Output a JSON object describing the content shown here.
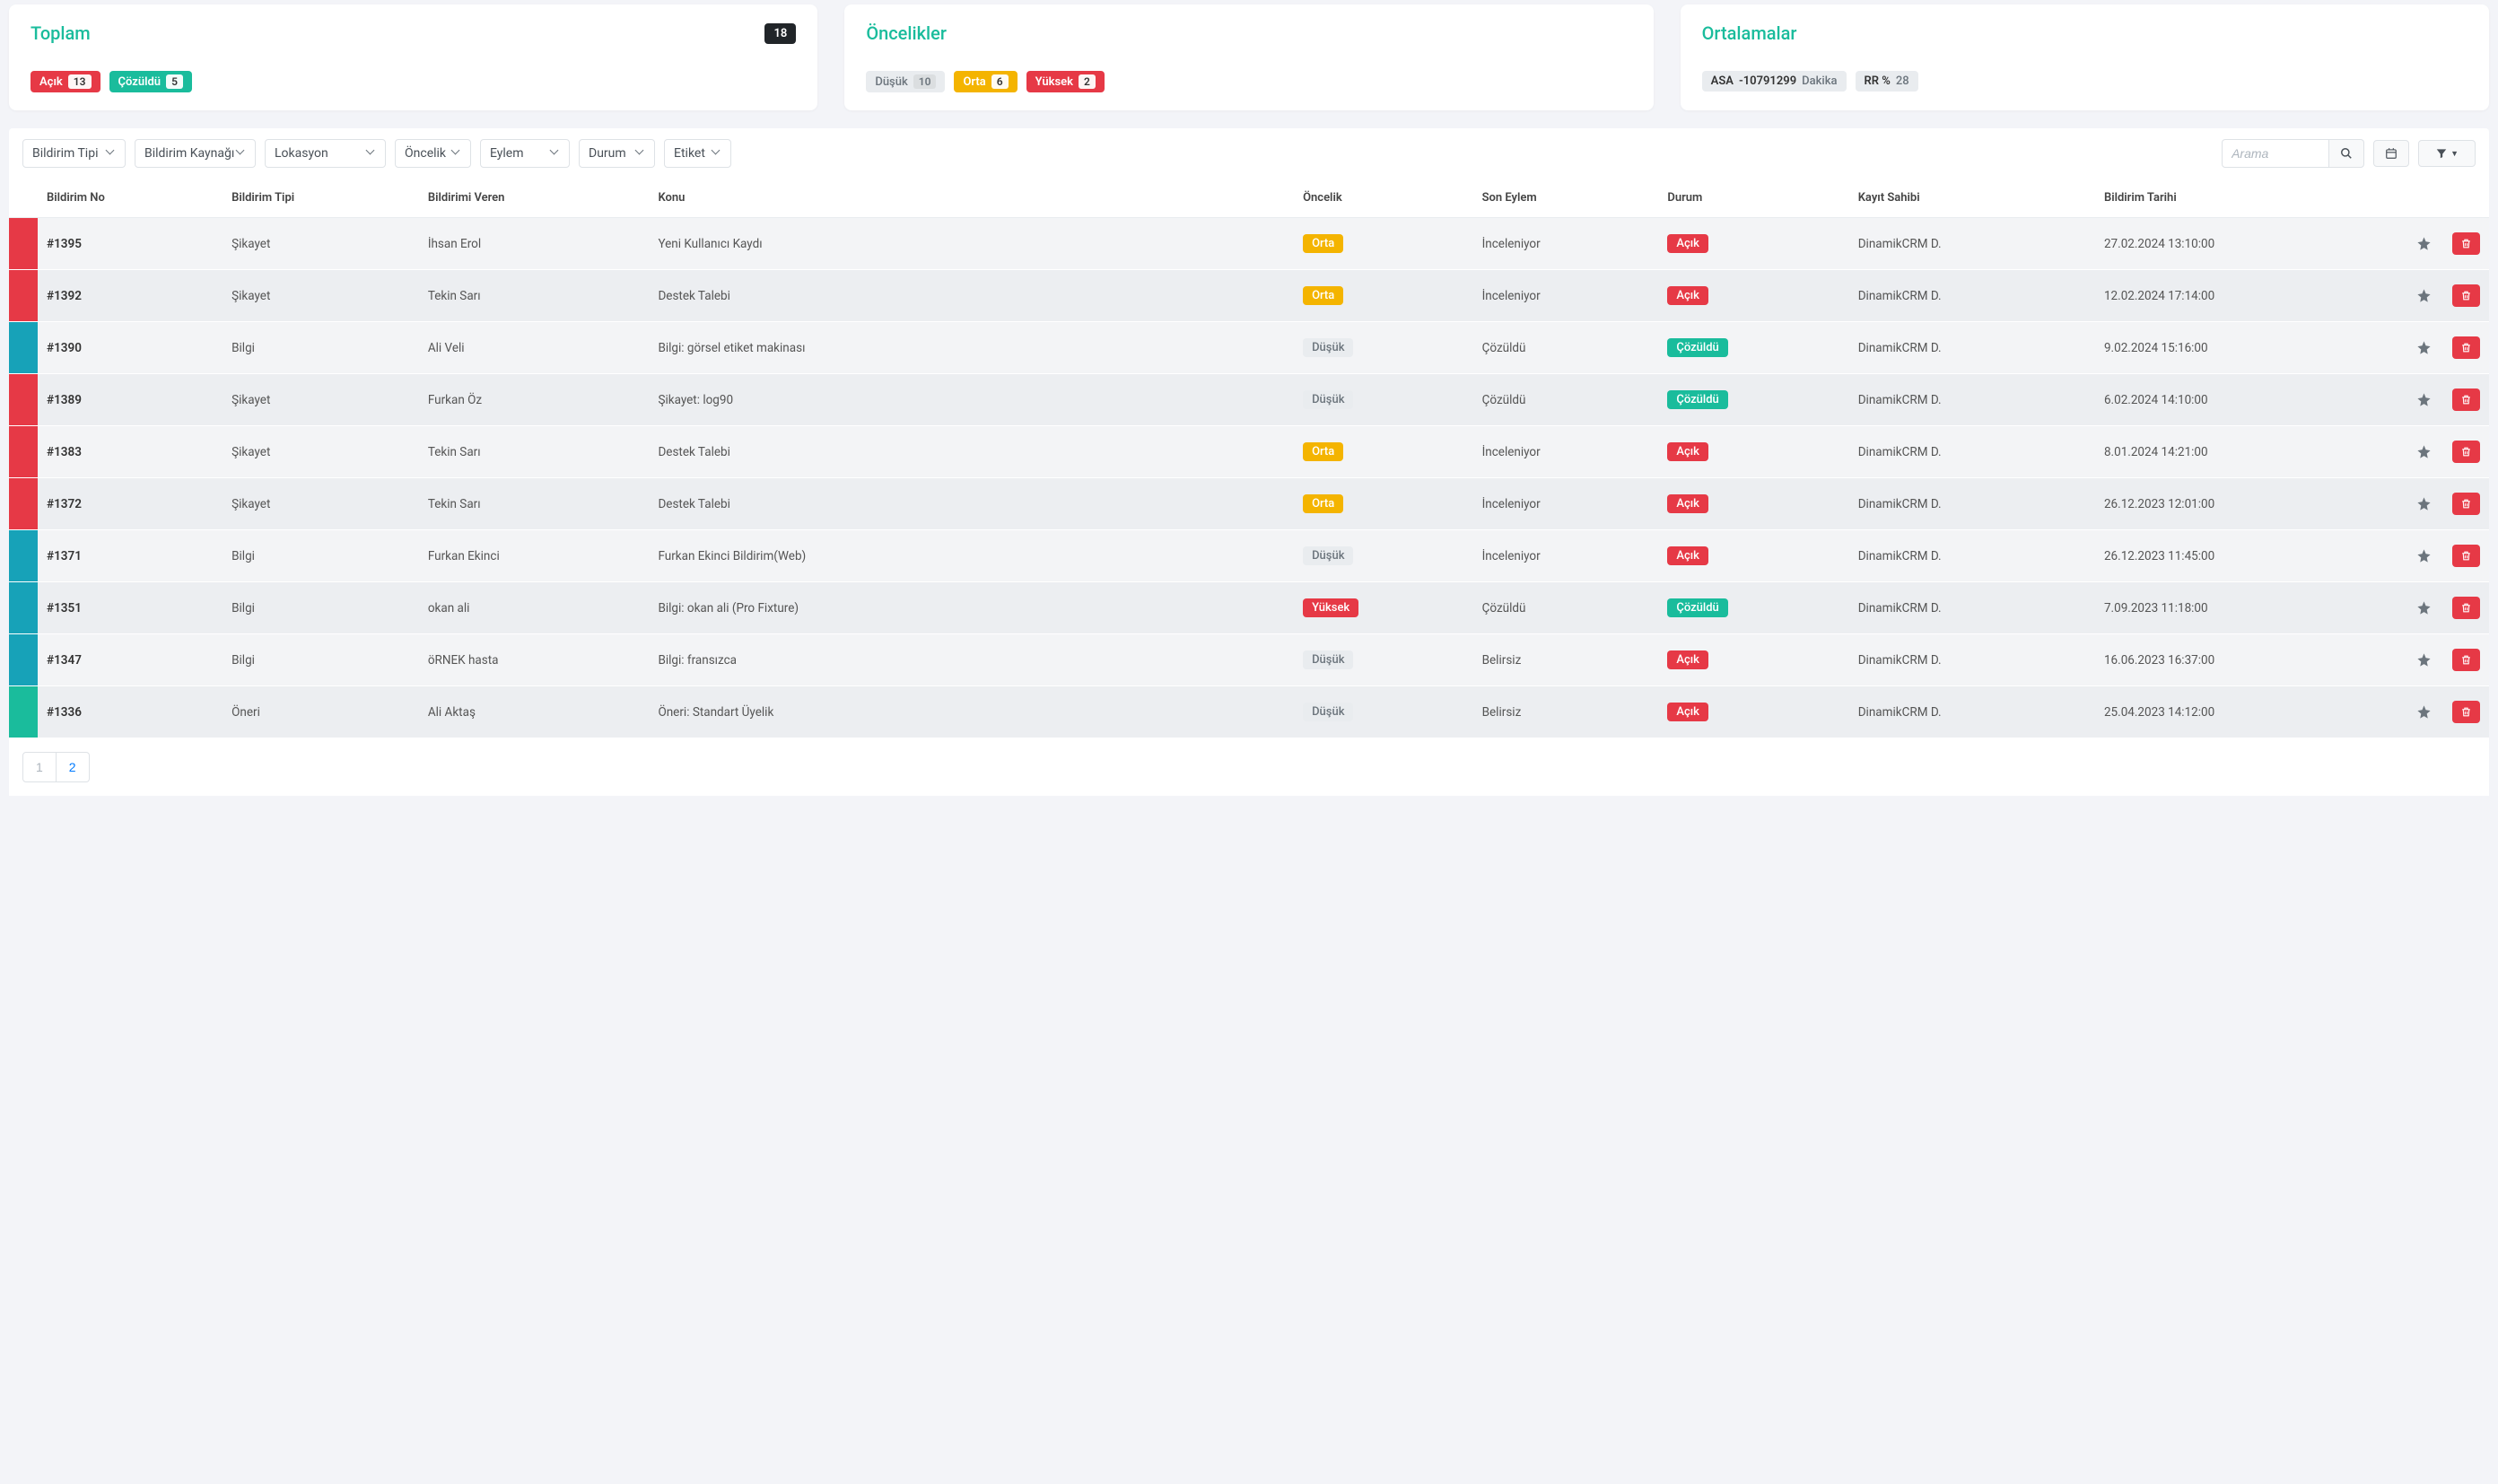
{
  "cards": {
    "total": {
      "title": "Toplam",
      "count": "18",
      "open_label": "Açık",
      "open_count": "13",
      "resolved_label": "Çözüldü",
      "resolved_count": "5"
    },
    "priorities": {
      "title": "Öncelikler",
      "low_label": "Düşük",
      "low_count": "10",
      "mid_label": "Orta",
      "mid_count": "6",
      "high_label": "Yüksek",
      "high_count": "2"
    },
    "averages": {
      "title": "Ortalamalar",
      "asa_label": "ASA",
      "asa_value": "-10791299",
      "asa_unit": "Dakika",
      "rr_label": "RR %",
      "rr_value": "28"
    }
  },
  "filters": {
    "type": "Bildirim Tipi",
    "source": "Bildirim Kaynağı",
    "location": "Lokasyon",
    "priority": "Öncelik",
    "action": "Eylem",
    "status": "Durum",
    "tag": "Etiket",
    "search_placeholder": "Arama"
  },
  "table": {
    "headers": {
      "id": "Bildirim No",
      "type": "Bildirim Tipi",
      "reporter": "Bildirimi Veren",
      "subject": "Konu",
      "priority": "Öncelik",
      "last_action": "Son Eylem",
      "status": "Durum",
      "owner": "Kayıt Sahibi",
      "date": "Bildirim Tarihi"
    },
    "rows": [
      {
        "bar": "red",
        "id": "#1395",
        "type": "Şikayet",
        "reporter": "İhsan Erol",
        "subject": "Yeni Kullanıcı Kaydı",
        "priority": "Orta",
        "priority_style": "yellow",
        "last_action": "İnceleniyor",
        "status": "Açık",
        "status_style": "red",
        "owner": "DinamikCRM D.",
        "date": "27.02.2024 13:10:00"
      },
      {
        "bar": "red",
        "id": "#1392",
        "type": "Şikayet",
        "reporter": "Tekin Sarı",
        "subject": "Destek Talebi",
        "priority": "Orta",
        "priority_style": "yellow",
        "last_action": "İnceleniyor",
        "status": "Açık",
        "status_style": "red",
        "owner": "DinamikCRM D.",
        "date": "12.02.2024 17:14:00"
      },
      {
        "bar": "teal",
        "id": "#1390",
        "type": "Bilgi",
        "reporter": "Ali Veli",
        "subject": "Bilgi: görsel etiket makinası",
        "priority": "Düşük",
        "priority_style": "gray",
        "last_action": "Çözüldü",
        "status": "Çözüldü",
        "status_style": "teal",
        "owner": "DinamikCRM D.",
        "date": "9.02.2024 15:16:00"
      },
      {
        "bar": "red",
        "id": "#1389",
        "type": "Şikayet",
        "reporter": "Furkan Öz",
        "subject": "Şikayet: log90",
        "priority": "Düşük",
        "priority_style": "gray",
        "last_action": "Çözüldü",
        "status": "Çözüldü",
        "status_style": "teal",
        "owner": "DinamikCRM D.",
        "date": "6.02.2024 14:10:00"
      },
      {
        "bar": "red",
        "id": "#1383",
        "type": "Şikayet",
        "reporter": "Tekin Sarı",
        "subject": "Destek Talebi",
        "priority": "Orta",
        "priority_style": "yellow",
        "last_action": "İnceleniyor",
        "status": "Açık",
        "status_style": "red",
        "owner": "DinamikCRM D.",
        "date": "8.01.2024 14:21:00"
      },
      {
        "bar": "red",
        "id": "#1372",
        "type": "Şikayet",
        "reporter": "Tekin Sarı",
        "subject": "Destek Talebi",
        "priority": "Orta",
        "priority_style": "yellow",
        "last_action": "İnceleniyor",
        "status": "Açık",
        "status_style": "red",
        "owner": "DinamikCRM D.",
        "date": "26.12.2023 12:01:00"
      },
      {
        "bar": "teal",
        "id": "#1371",
        "type": "Bilgi",
        "reporter": "Furkan Ekinci",
        "subject": "Furkan Ekinci Bildirim(Web)",
        "priority": "Düşük",
        "priority_style": "gray",
        "last_action": "İnceleniyor",
        "status": "Açık",
        "status_style": "red",
        "owner": "DinamikCRM D.",
        "date": "26.12.2023 11:45:00"
      },
      {
        "bar": "teal",
        "id": "#1351",
        "type": "Bilgi",
        "reporter": "okan ali",
        "subject": "Bilgi: okan ali (Pro Fixture)",
        "priority": "Yüksek",
        "priority_style": "red",
        "last_action": "Çözüldü",
        "status": "Çözüldü",
        "status_style": "teal",
        "owner": "DinamikCRM D.",
        "date": "7.09.2023 11:18:00"
      },
      {
        "bar": "teal",
        "id": "#1347",
        "type": "Bilgi",
        "reporter": "öRNEK hasta",
        "subject": "Bilgi: fransızca",
        "priority": "Düşük",
        "priority_style": "gray",
        "last_action": "Belirsiz",
        "status": "Açık",
        "status_style": "red",
        "owner": "DinamikCRM D.",
        "date": "16.06.2023 16:37:00"
      },
      {
        "bar": "green",
        "id": "#1336",
        "type": "Öneri",
        "reporter": "Ali Aktaş",
        "subject": "Öneri: Standart Üyelik",
        "priority": "Düşük",
        "priority_style": "gray",
        "last_action": "Belirsiz",
        "status": "Açık",
        "status_style": "red",
        "owner": "DinamikCRM D.",
        "date": "25.04.2023 14:12:00"
      }
    ]
  },
  "pagination": {
    "page1": "1",
    "page2": "2"
  }
}
